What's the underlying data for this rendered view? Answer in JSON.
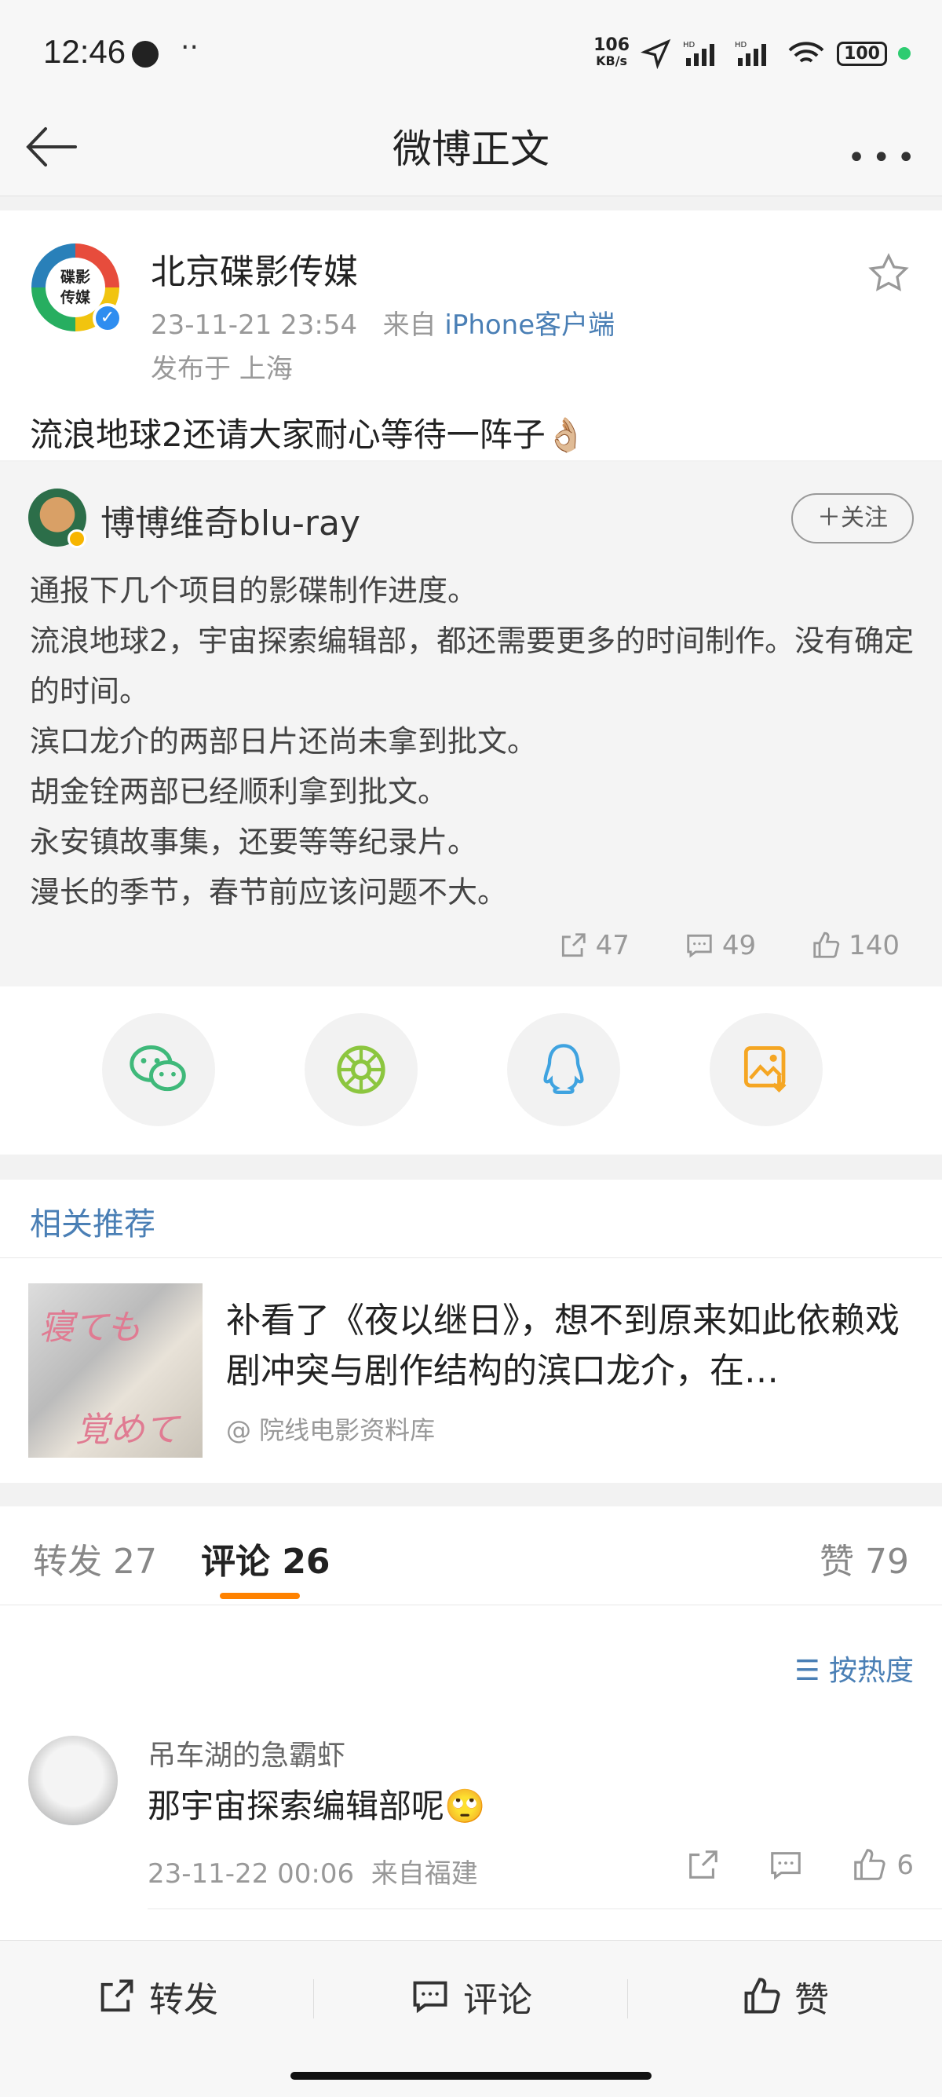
{
  "status": {
    "time": "12:46",
    "dots": "··",
    "net_speed_top": "106",
    "net_speed_bottom": "KB/s",
    "battery": "100"
  },
  "nav": {
    "title": "微博正文"
  },
  "post": {
    "author": "北京碟影传媒",
    "avatar_text": "碟影\n传媒",
    "date": "23-11-21 23:54",
    "from_prefix": "来自",
    "source": "iPhone客户端",
    "location": "发布于 上海",
    "content": "流浪地球2还请大家耐心等待一阵子👌🏼"
  },
  "repost": {
    "author": "博博维奇blu-ray",
    "follow_label": "＋关注",
    "lines": [
      "通报下几个项目的影碟制作进度。",
      "流浪地球2，宇宙探索编辑部，都还需要更多的时间制作。没有确定的时间。",
      "滨口龙介的两部日片还尚未拿到批文。",
      "胡金铨两部已经顺利拿到批文。",
      "永安镇故事集，还要等等纪录片。",
      "漫长的季节，春节前应该问题不大。"
    ],
    "reposts": "47",
    "comments": "49",
    "likes": "140"
  },
  "share": [
    "wechat-icon",
    "moments-icon",
    "qq-icon",
    "save-image-icon"
  ],
  "recommend": {
    "heading": "相关推荐",
    "title": "补看了《夜以继日》，想不到原来如此依赖戏剧冲突与剧作结构的滨口龙介，在…",
    "source": "@ 院线电影资料库",
    "image_text_1": "寝ても",
    "image_text_2": "覚めても"
  },
  "tabs": {
    "repost": "转发 27",
    "comment": "评论 26",
    "like": "赞 79"
  },
  "comments": {
    "sort_label": "按热度",
    "items": [
      {
        "name": "吊车湖的急霸虾",
        "text": "那宇宙探索编辑部呢🙄",
        "time": "23-11-22 00:06",
        "location": "来自福建",
        "likes": "6"
      }
    ]
  },
  "bottom": {
    "repost": "转发",
    "comment": "评论",
    "like": "赞"
  }
}
